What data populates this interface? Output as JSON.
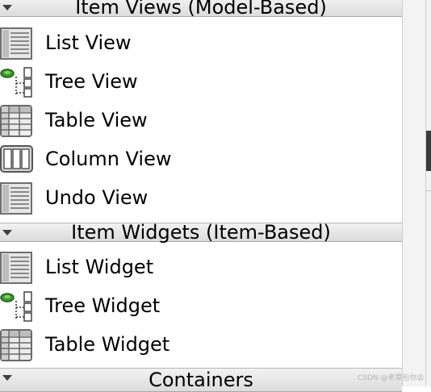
{
  "sections": [
    {
      "title": "Item Views (Model-Based)",
      "items": [
        {
          "label": "List View",
          "icon": "list-view-icon"
        },
        {
          "label": "Tree View",
          "icon": "tree-view-icon"
        },
        {
          "label": "Table View",
          "icon": "table-view-icon"
        },
        {
          "label": "Column View",
          "icon": "column-view-icon"
        },
        {
          "label": "Undo View",
          "icon": "undo-view-icon"
        }
      ]
    },
    {
      "title": "Item Widgets (Item-Based)",
      "items": [
        {
          "label": "List Widget",
          "icon": "list-widget-icon"
        },
        {
          "label": "Tree Widget",
          "icon": "tree-widget-icon"
        },
        {
          "label": "Table Widget",
          "icon": "table-widget-icon"
        }
      ]
    },
    {
      "title": "Containers",
      "items": []
    }
  ],
  "watermark": "CSDN @老菜包你会"
}
